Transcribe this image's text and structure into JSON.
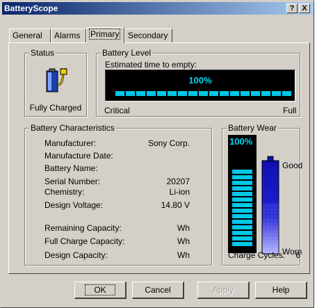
{
  "window": {
    "title": "BatteryScope",
    "help_label": "?",
    "close_label": "X"
  },
  "tabs": [
    "General",
    "Alarms",
    "Primary",
    "Secondary"
  ],
  "active_tab": "Primary",
  "status": {
    "group_label": "Status",
    "text": "Fully Charged",
    "icon": "battery-plug-icon"
  },
  "battery_level": {
    "group_label": "Battery Level",
    "subtitle": "Estimated time to empty:",
    "percent_text": "100%",
    "level": 1.0,
    "min_label": "Critical",
    "max_label": "Full",
    "color": "#00c8e8"
  },
  "characteristics": {
    "group_label": "Battery Characteristics",
    "rows": [
      {
        "label": "Manufacturer:",
        "value": "Sony Corp."
      },
      {
        "label": "Manufacture Date:",
        "value": ""
      },
      {
        "label": "Battery Name:",
        "value": ""
      },
      {
        "label": "Serial Number:",
        "value": "20207"
      },
      {
        "label": "Chemistry:",
        "value": "Li-ion"
      },
      {
        "label": "Design Voltage:",
        "value": "14.80 V"
      },
      {
        "label": "Remaining Capacity:",
        "value": "Wh"
      },
      {
        "label": "Full Charge Capacity:",
        "value": "Wh"
      },
      {
        "label": "Design Capacity:",
        "value": "Wh"
      }
    ]
  },
  "wear": {
    "group_label": "Battery Wear",
    "percent_text": "100%",
    "good_label": "Good",
    "worn_label": "Worn",
    "cycles_label": "Charge Cycles:",
    "cycles_value": "6",
    "wear_level": 0.9
  },
  "buttons": {
    "ok": "OK",
    "cancel": "Cancel",
    "apply": "Apply",
    "help": "Help"
  }
}
